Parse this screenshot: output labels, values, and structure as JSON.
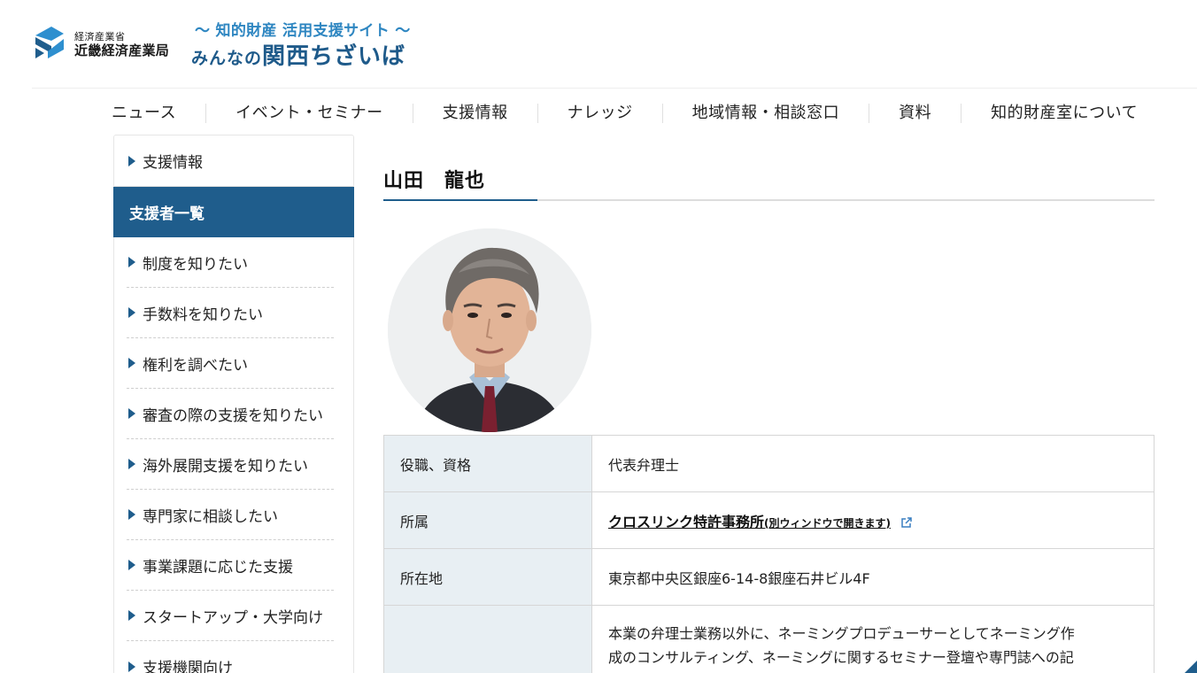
{
  "header": {
    "ministry": "経済産業省",
    "bureau": "近畿経済産業局",
    "tagline": "〜 知的財産 活用支援サイト 〜",
    "site_name_pre": "みんなの",
    "site_name_main": "関西ちざいば"
  },
  "nav": {
    "items": [
      "ニュース",
      "イベント・セミナー",
      "支援情報",
      "ナレッジ",
      "地域情報・相談窓口",
      "資料",
      "知的財産室について"
    ]
  },
  "sidebar": {
    "head": "支援情報",
    "active": "支援者一覧",
    "items": [
      "制度を知りたい",
      "手数料を知りたい",
      "権利を調べたい",
      "審査の際の支援を知りたい",
      "海外展開支援を知りたい",
      "専門家に相談したい",
      "事業課題に応じた支援",
      "スタートアップ・大学向け",
      "支援機関向け"
    ]
  },
  "profile": {
    "name": "山田　龍也",
    "rows": {
      "title_label": "役職、資格",
      "title_value": "代表弁理士",
      "affiliation_label": "所属",
      "affiliation_link": "クロスリンク特許事務所",
      "affiliation_note": "(別ウィンドウで開きます)",
      "address_label": "所在地",
      "address_value": "東京都中央区銀座6-14-8銀座石井ビル4F",
      "description_line1": "本業の弁理士業務以外に、ネーミングプロデューサーとしてネーミング作",
      "description_line2": "成のコンサルティング、ネーミングに関するセミナー登壇や専門誌への記"
    }
  },
  "colors": {
    "brand_blue": "#1f5d8c",
    "tagline_blue": "#2e86c1",
    "table_header_bg": "#e8eff3"
  },
  "icons": [
    "logo-mark",
    "triangle-bullet-icon",
    "external-link-icon"
  ]
}
